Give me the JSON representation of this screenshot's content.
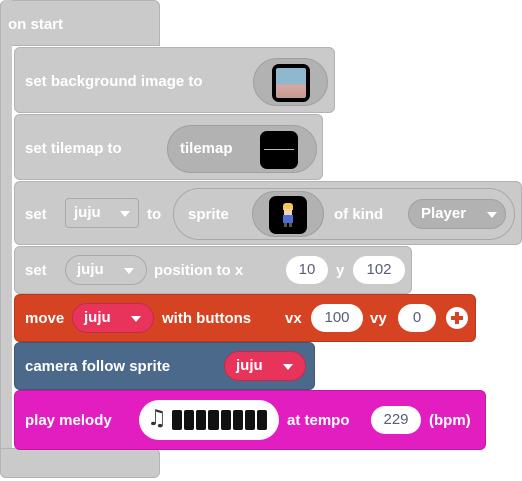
{
  "event": {
    "label": "on start"
  },
  "blocks": {
    "background": {
      "label": "set background image to"
    },
    "tilemap": {
      "label": "set tilemap to",
      "value": "tilemap"
    },
    "set_sprite": {
      "prefix": "set",
      "variable": "juju",
      "to": "to",
      "sprite_label": "sprite",
      "of_kind": "of kind",
      "kind": "Player"
    },
    "position": {
      "prefix": "set",
      "variable": "juju",
      "label": "position to x",
      "x": "10",
      "y_label": "y",
      "y": "102"
    },
    "move": {
      "label": "move",
      "variable": "juju",
      "with_buttons": "with buttons",
      "vx_label": "vx",
      "vx": "100",
      "vy_label": "vy",
      "vy": "0"
    },
    "camera": {
      "label": "camera follow sprite",
      "variable": "juju"
    },
    "melody": {
      "label": "play melody",
      "at_tempo": "at tempo",
      "tempo": "229",
      "unit": "(bpm)"
    }
  },
  "colors": {
    "event_grey": "#cacaca",
    "controller_red": "#d54322",
    "scene_blue": "#4b6a8b",
    "music_magenta": "#e31ec1"
  },
  "icons": [
    "music-note-icon",
    "add-icon",
    "dropdown-arrow-icon"
  ]
}
